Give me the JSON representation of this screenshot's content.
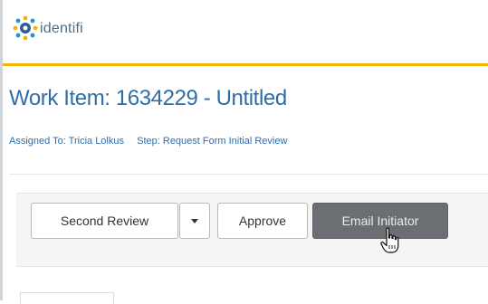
{
  "app": {
    "brand": "identifi"
  },
  "work_item": {
    "title": "Work Item: 1634229 - Untitled",
    "assigned_label": "Assigned To:",
    "assigned_to": "Tricia Lolkus",
    "step_label": "Step:",
    "step": "Request Form Initial Review"
  },
  "toolbar": {
    "second_review_label": "Second Review",
    "approve_label": "Approve",
    "email_initiator_label": "Email Initiator"
  },
  "colors": {
    "accent_line": "#f5b400",
    "title_blue": "#2f6da8",
    "active_button": "#6b6f74"
  },
  "icons": {
    "logo": "identifi-logo-icon",
    "dropdown": "caret-down-icon",
    "cursor": "hand-pointer-icon"
  }
}
